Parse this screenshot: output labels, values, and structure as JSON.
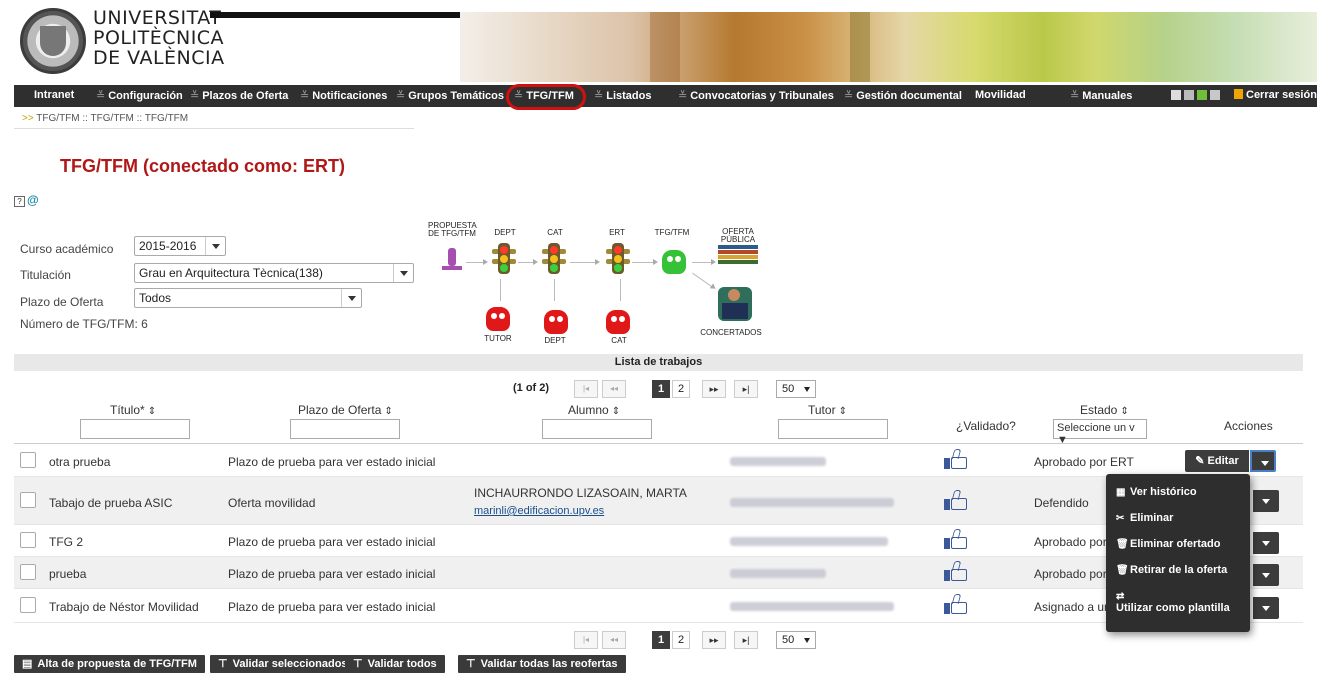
{
  "header": {
    "logo_lines": [
      "UNIVERSITAT",
      "POLITÈCNICA",
      "DE VALÈNCIA"
    ]
  },
  "nav": {
    "items": [
      {
        "label": "Intranet",
        "sep": ""
      },
      {
        "label": "Configuración",
        "sep": "≚"
      },
      {
        "label": "Plazos de Oferta",
        "sep": "≚"
      },
      {
        "label": "Notificaciones",
        "sep": "≚"
      },
      {
        "label": "Grupos Temáticos",
        "sep": "≚"
      },
      {
        "label": "TFG/TFM",
        "sep": "≚"
      },
      {
        "label": "Listados",
        "sep": "≚"
      },
      {
        "label": "Convocatorias y Tribunales",
        "sep": "≚"
      },
      {
        "label": "Gestión documental",
        "sep": "≚"
      },
      {
        "label": "Movilidad",
        "sep": ""
      },
      {
        "label": "Manuales",
        "sep": "≚"
      }
    ],
    "logout_label": "Cerrar sesión",
    "highlight_color": "#d21010"
  },
  "breadcrumb": {
    "arrow": ">>",
    "text": "TFG/TFM :: TFG/TFM :: TFG/TFM"
  },
  "page_title": "TFG/TFM (conectado como: ERT)",
  "help": {
    "q": "?",
    "at": "@"
  },
  "filters": {
    "curso_label": "Curso académico",
    "curso_value": "2015-2016",
    "titulacion_label": "Titulación",
    "titulacion_value": "Grau en Arquitectura Tècnica(138)",
    "plazo_label": "Plazo de Oferta",
    "plazo_value": "Todos",
    "count_text": "Número de TFG/TFM: 6"
  },
  "workflow": {
    "propuesta": "PROPUESTA DE TFG/TFM",
    "dept": "DEPT",
    "cat": "CAT",
    "ert": "ERT",
    "tfgtfm": "TFG/TFM",
    "oferta": "OFERTA PÚBLICA",
    "concertados": "CONCERTADOS",
    "tutor": "TUTOR",
    "dept2": "DEPT",
    "cat2": "CAT"
  },
  "table": {
    "caption": "Lista de trabajos",
    "pager": {
      "info": "(1 of 2)",
      "first": "|◂",
      "prev": "◂◂",
      "pages": [
        "1",
        "2"
      ],
      "next": "▸▸",
      "last": "▸|",
      "rows_per_page": "50"
    },
    "columns": {
      "titulo": "Título*",
      "plazo": "Plazo de Oferta",
      "alumno": "Alumno",
      "tutor": "Tutor",
      "validado": "¿Validado?",
      "estado": "Estado",
      "acciones": "Acciones",
      "sort_icon": "⇕",
      "estado_filter": "Seleccione un v"
    },
    "rows": [
      {
        "titulo": "otra prueba",
        "plazo": "Plazo de prueba para ver estado inicial",
        "alumno": "",
        "email": "",
        "estado": "Aprobado por ERT"
      },
      {
        "titulo": "Tabajo de prueba ASIC",
        "plazo": "Oferta movilidad",
        "alumno": "INCHAURRONDO LIZASOAIN, MARTA",
        "email": "marinli@edificacion.upv.es",
        "estado": "Defendido"
      },
      {
        "titulo": "TFG 2",
        "plazo": "Plazo de prueba para ver estado inicial",
        "alumno": "",
        "email": "",
        "estado": "Aprobado por"
      },
      {
        "titulo": "prueba",
        "plazo": "Plazo de prueba para ver estado inicial",
        "alumno": "",
        "email": "",
        "estado": "Aprobado por"
      },
      {
        "titulo": "Trabajo de Néstor Movilidad",
        "plazo": "Plazo de prueba para ver estado inicial",
        "alumno": "",
        "email": "",
        "estado": "Asignado a un"
      }
    ],
    "edit_label": "Editar"
  },
  "menu": {
    "items": [
      {
        "icon": "▦",
        "label": "Ver histórico"
      },
      {
        "icon": "✂",
        "label": "Eliminar"
      },
      {
        "icon": "🗑",
        "label": "Eliminar ofertado"
      },
      {
        "icon": "🗑",
        "label": "Retirar de la oferta"
      },
      {
        "icon": "⇄",
        "label": "Utilizar como plantilla"
      }
    ]
  },
  "bottom_buttons": [
    {
      "icon": "▤",
      "label": "Alta de propuesta de TFG/TFM"
    },
    {
      "icon": "⊤",
      "label": "Validar seleccionados"
    },
    {
      "icon": "⊤",
      "label": "Validar todos"
    },
    {
      "icon": "⊤",
      "label": "Validar todas las reofertas"
    }
  ]
}
